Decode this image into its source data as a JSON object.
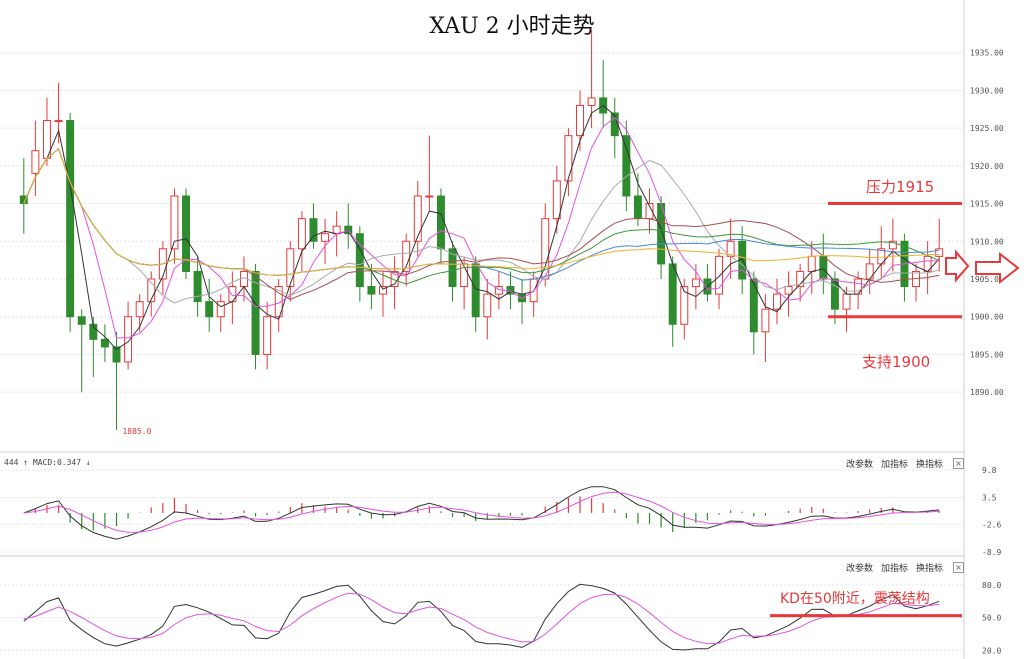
{
  "title": "XAU 2 小时走势",
  "price_axis": {
    "ticks": [
      "1935.00",
      "1930.00",
      "1925.00",
      "1920.00",
      "1915.00",
      "1910.00",
      "1905.00",
      "1900.00",
      "1895.00",
      "1890.00"
    ],
    "min": 1883,
    "max": 1938
  },
  "low_label": "1885.0",
  "macd_panel": {
    "label_prefix": "444 ↑ MACD:0.347 ↓",
    "ticks": [
      "9.8",
      "3.5",
      "-2.6",
      "-8.9"
    ],
    "buttons": [
      "改参数",
      "加指标",
      "换指标"
    ],
    "close": "×"
  },
  "kd_panel": {
    "ticks": [
      "80.0",
      "50.0",
      "20.0"
    ],
    "buttons": [
      "改参数",
      "加指标",
      "换指标"
    ],
    "close": "×"
  },
  "annotations": {
    "resistance": "压力1915",
    "support": "支持1900",
    "kd_note": "KD在50附近，震荡结构"
  },
  "colors": {
    "up": "#e8393a",
    "down": "#2e8b2e",
    "annot": "#e8393a",
    "ma_magenta": "#e055e0",
    "ma_black": "#333333",
    "ma_gray": "#aaaaaa",
    "ma_brown": "#a85050",
    "ma_green": "#3a9a3a",
    "ma_blue": "#4a8ad0",
    "ma_orange": "#f0b030"
  },
  "chart_data": {
    "type": "candlestick",
    "title": "XAU 2 小时走势",
    "levels": {
      "resistance": 1915,
      "support": 1900
    },
    "low": 1885.0,
    "candles": [
      [
        1916,
        1921,
        1911,
        1915
      ],
      [
        1919,
        1926,
        1916,
        1922
      ],
      [
        1921,
        1929,
        1920,
        1926
      ],
      [
        1926,
        1931,
        1923,
        1926
      ],
      [
        1926,
        1927,
        1898,
        1900
      ],
      [
        1900,
        1901,
        1890,
        1899
      ],
      [
        1899,
        1900,
        1892,
        1897
      ],
      [
        1897,
        1899,
        1894,
        1896
      ],
      [
        1896,
        1898,
        1885,
        1894
      ],
      [
        1894,
        1902,
        1893,
        1900
      ],
      [
        1900,
        1903,
        1898,
        1902
      ],
      [
        1902,
        1906,
        1900,
        1905
      ],
      [
        1905,
        1910,
        1903,
        1909
      ],
      [
        1909,
        1917,
        1907,
        1916
      ],
      [
        1916,
        1917,
        1905,
        1906
      ],
      [
        1906,
        1908,
        1900,
        1902
      ],
      [
        1902,
        1905,
        1898,
        1900
      ],
      [
        1900,
        1903,
        1898,
        1902
      ],
      [
        1902,
        1906,
        1899,
        1904
      ],
      [
        1904,
        1908,
        1902,
        1906
      ],
      [
        1906,
        1907,
        1893,
        1895
      ],
      [
        1895,
        1902,
        1893,
        1900
      ],
      [
        1900,
        1905,
        1898,
        1904
      ],
      [
        1904,
        1910,
        1902,
        1909
      ],
      [
        1909,
        1914,
        1906,
        1913
      ],
      [
        1913,
        1915,
        1909,
        1910
      ],
      [
        1910,
        1913,
        1907,
        1911
      ],
      [
        1911,
        1914,
        1908,
        1912
      ],
      [
        1912,
        1915,
        1909,
        1911
      ],
      [
        1911,
        1912,
        1902,
        1904
      ],
      [
        1904,
        1907,
        1901,
        1903
      ],
      [
        1903,
        1906,
        1900,
        1904
      ],
      [
        1904,
        1908,
        1901,
        1906
      ],
      [
        1906,
        1911,
        1904,
        1910
      ],
      [
        1910,
        1918,
        1908,
        1916
      ],
      [
        1916,
        1924,
        1914,
        1916
      ],
      [
        1916,
        1917,
        1907,
        1909
      ],
      [
        1909,
        1910,
        1902,
        1904
      ],
      [
        1904,
        1908,
        1901,
        1907
      ],
      [
        1907,
        1908,
        1898,
        1900
      ],
      [
        1900,
        1905,
        1897,
        1903
      ],
      [
        1903,
        1906,
        1901,
        1904
      ],
      [
        1904,
        1906,
        1901,
        1903
      ],
      [
        1903,
        1905,
        1899,
        1902
      ],
      [
        1902,
        1906,
        1900,
        1905
      ],
      [
        1905,
        1915,
        1904,
        1913
      ],
      [
        1913,
        1920,
        1911,
        1918
      ],
      [
        1918,
        1925,
        1916,
        1924
      ],
      [
        1924,
        1930,
        1922,
        1928
      ],
      [
        1928,
        1938,
        1925,
        1929
      ],
      [
        1929,
        1934,
        1925,
        1927
      ],
      [
        1927,
        1929,
        1921,
        1924
      ],
      [
        1924,
        1926,
        1914,
        1916
      ],
      [
        1916,
        1919,
        1912,
        1913
      ],
      [
        1913,
        1917,
        1911,
        1915
      ],
      [
        1915,
        1916,
        1905,
        1907
      ],
      [
        1907,
        1908,
        1896,
        1899
      ],
      [
        1899,
        1905,
        1897,
        1904
      ],
      [
        1904,
        1907,
        1901,
        1905
      ],
      [
        1905,
        1907,
        1902,
        1903
      ],
      [
        1903,
        1909,
        1901,
        1908
      ],
      [
        1908,
        1913,
        1905,
        1910
      ],
      [
        1910,
        1912,
        1903,
        1905
      ],
      [
        1905,
        1906,
        1895,
        1898
      ],
      [
        1898,
        1903,
        1894,
        1901
      ],
      [
        1901,
        1905,
        1899,
        1903
      ],
      [
        1903,
        1906,
        1900,
        1904
      ],
      [
        1904,
        1907,
        1902,
        1906
      ],
      [
        1906,
        1910,
        1903,
        1908
      ],
      [
        1908,
        1911,
        1903,
        1905
      ],
      [
        1905,
        1906,
        1899,
        1901
      ],
      [
        1901,
        1904,
        1898,
        1903
      ],
      [
        1903,
        1906,
        1901,
        1905
      ],
      [
        1905,
        1909,
        1903,
        1907
      ],
      [
        1907,
        1912,
        1905,
        1909
      ],
      [
        1909,
        1913,
        1906,
        1910
      ],
      [
        1910,
        1911,
        1902,
        1904
      ],
      [
        1904,
        1907,
        1902,
        1906
      ],
      [
        1906,
        1910,
        1903,
        1908
      ],
      [
        1908,
        1913,
        1906,
        1909
      ]
    ]
  }
}
